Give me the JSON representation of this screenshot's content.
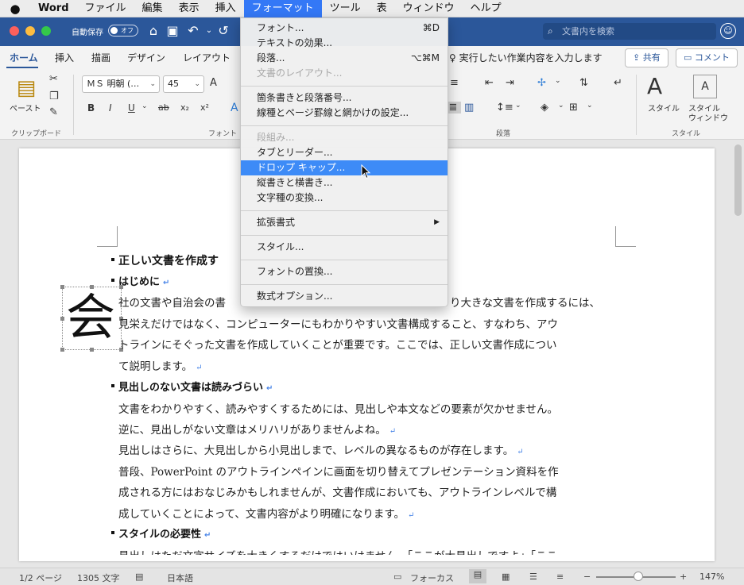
{
  "menubar": {
    "apple": "",
    "app": "Word",
    "items": [
      "ファイル",
      "編集",
      "表示",
      "挿入",
      "フォーマット",
      "ツール",
      "表",
      "ウィンドウ",
      "ヘルプ"
    ]
  },
  "titlebar": {
    "autosave": "自動保存",
    "toggle": "オフ",
    "search_placeholder": "文書内を検索"
  },
  "ribbon_tabs": [
    "ホーム",
    "挿入",
    "描画",
    "デザイン",
    "レイアウト"
  ],
  "tellme": "実行したい作業内容を入力します",
  "share": "共有",
  "comment": "コメント",
  "ribbon": {
    "paste": "ペースト",
    "font_name": "ＭＳ 明朝 (…",
    "font_size": "45",
    "groups": {
      "clipboard": "クリップボード",
      "font": "フォント",
      "paragraph": "段落",
      "style": "スタイル"
    },
    "style_btn": "スタイル",
    "style_window_1": "スタイル",
    "style_window_2": "ウィンドウ"
  },
  "menu": {
    "font": "フォント...",
    "font_sc": "⌘D",
    "text_effects": "テキストの効果...",
    "paragraph": "段落...",
    "paragraph_sc": "⌥⌘M",
    "doc_layout": "文書のレイアウト...",
    "bullets": "箇条書きと段落番号...",
    "borders": "線種とページ罫線と網かけの設定...",
    "columns": "段組み...",
    "tabs": "タブとリーダー...",
    "dropcap": "ドロップ キャップ...",
    "vertical": "縦書きと横書き...",
    "change_case": "文字種の変換...",
    "ext_format": "拡張書式",
    "style": "スタイル...",
    "replace_fonts": "フォントの置換...",
    "equation": "数式オプション..."
  },
  "document": {
    "h1": "正しい文書を作成す",
    "h_intro": "はじめに",
    "dropcap_char": "会",
    "p1a": "社の文書や自治会の書",
    "p1b": "り大きな文書を作成するには、",
    "p2": "見栄えだけではなく、コンピューターにもわかりやすい文書構成すること、すなわち、アウ",
    "p3": "トラインにそぐった文書を作成していくことが重要です。ここでは、正しい文書作成につい",
    "p4": "て説明します。",
    "h2": "見出しのない文書は読みづらい",
    "p5": "文書をわかりやすく、読みやすくするためには、見出しや本文などの要素が欠かせません。",
    "p6": "逆に、見出しがない文章はメリハリがありませんよね。",
    "p7": "見出しはさらに、大見出しから小見出しまで、レベルの異なるものが存在します。",
    "p8": "普段、PowerPoint のアウトラインペインに画面を切り替えてプレゼンテーション資料を作",
    "p9": "成される方にはおなじみかもしれませんが、文書作成においても、アウトラインレベルで構",
    "p10": "成していくことによって、文書内容がより明確になります。",
    "h3": "スタイルの必要性",
    "p11": "見出しはただ文字サイズを大きくするだけではいけません。「ここが大見出しですよ」「ここ"
  },
  "status": {
    "page": "1/2 ページ",
    "words": "1305 文字",
    "lang": "日本語",
    "focus": "フォーカス",
    "zoom": "147%"
  },
  "colors": {
    "title_bar": "#2b579a",
    "menu_highlight": "#3d8bf7"
  }
}
